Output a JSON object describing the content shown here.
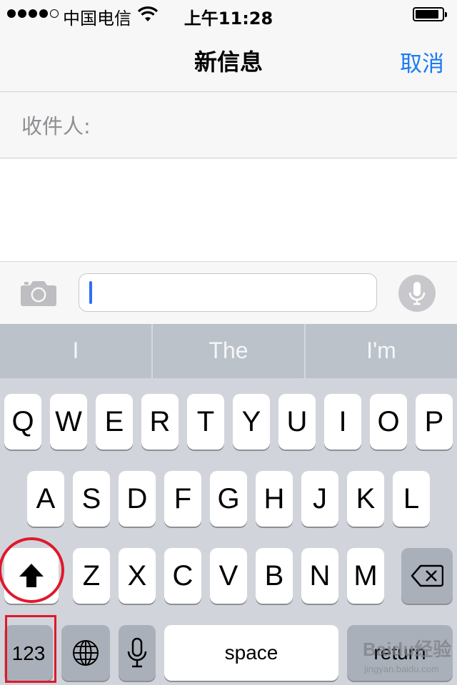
{
  "status_bar": {
    "carrier": "中国电信",
    "time": "上午11:28",
    "signal_bars_filled": 4,
    "signal_bars_total": 5,
    "battery_level": 0.8
  },
  "nav": {
    "title": "新信息",
    "cancel_label": "取消"
  },
  "recipient": {
    "label": "收件人:"
  },
  "input_bar": {
    "text_value": ""
  },
  "suggestions": [
    "I",
    "The",
    "I'm"
  ],
  "keyboard": {
    "row1": [
      "Q",
      "W",
      "E",
      "R",
      "T",
      "Y",
      "U",
      "I",
      "O",
      "P"
    ],
    "row2": [
      "A",
      "S",
      "D",
      "F",
      "G",
      "H",
      "J",
      "K",
      "L"
    ],
    "row3": [
      "Z",
      "X",
      "C",
      "V",
      "B",
      "N",
      "M"
    ],
    "numbers_label": "123",
    "space_label": "space",
    "return_label": "return"
  },
  "watermark": {
    "text": "Baidu经验",
    "url": "jingyan.baidu.com"
  },
  "colors": {
    "accent": "#1b7cf2",
    "annotation": "#e0182b",
    "keyboard_bg": "#d1d5db",
    "suggestion_bg": "#bcc2ca"
  }
}
